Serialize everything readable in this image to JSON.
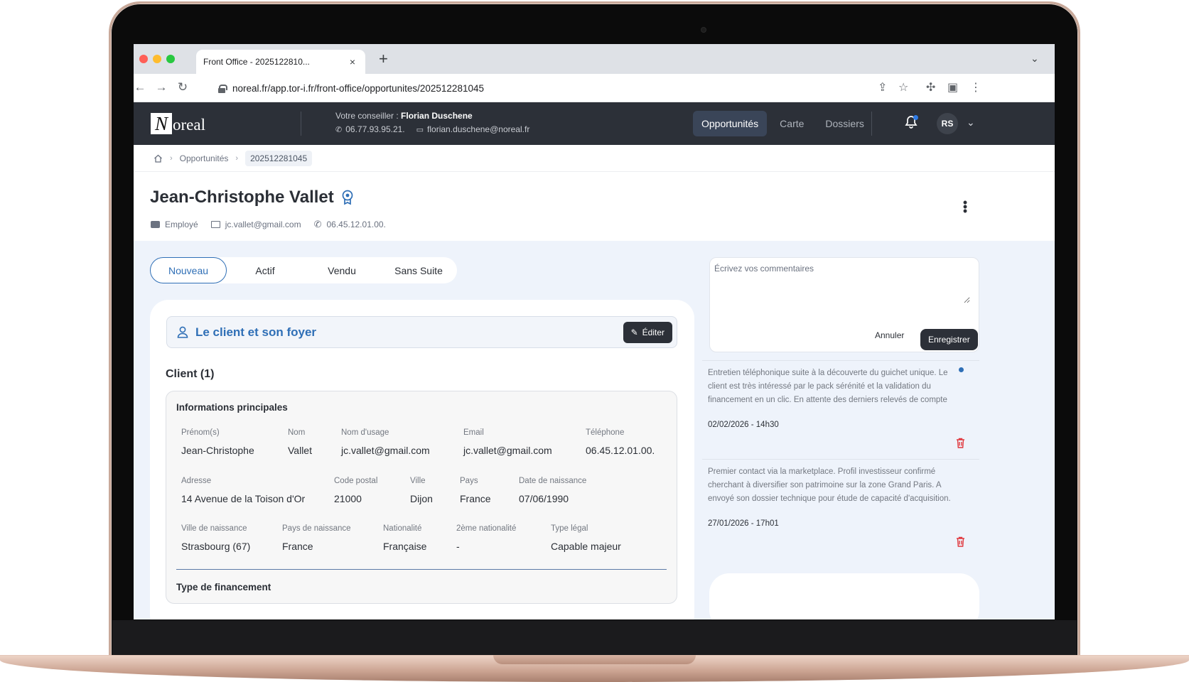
{
  "browser": {
    "tab_title": "Front Office - 2025122810...",
    "tab_close": "×",
    "new_tab": "+",
    "url": "noreal.fr/app.tor-i.fr/front-office/opportunites/202512281045"
  },
  "header": {
    "logo_letter": "N",
    "logo_rest": "oreal",
    "advisor_label": "Votre conseiller : ",
    "advisor_name": "Florian Duschene",
    "advisor_phone": "06.77.93.95.21.",
    "advisor_email": "florian.duschene@noreal.fr",
    "nav": [
      "Opportunités",
      "Carte",
      "Dossiers"
    ],
    "avatar_initials": "RS"
  },
  "breadcrumb": {
    "items": [
      "Opportunités",
      "202512281045"
    ]
  },
  "client": {
    "name": "Jean-Christophe Vallet",
    "status": "Employé",
    "email": "jc.vallet@gmail.com",
    "phone": "06.45.12.01.00."
  },
  "status_tabs": [
    "Nouveau",
    "Actif",
    "Vendu",
    "Sans Suite"
  ],
  "section": {
    "title": "Le client et son foyer",
    "edit_label": "Éditer",
    "client_count": "Client (1)",
    "info_title": "Informations principales",
    "fields": {
      "prenom": {
        "label": "Prénom(s)",
        "value": "Jean-Christophe"
      },
      "nom": {
        "label": "Nom",
        "value": "Vallet"
      },
      "nom_usage": {
        "label": "Nom d'usage",
        "value": "jc.vallet@gmail.com"
      },
      "email": {
        "label": "Email",
        "value": "jc.vallet@gmail.com"
      },
      "telephone": {
        "label": "Téléphone",
        "value": "06.45.12.01.00."
      },
      "adresse": {
        "label": "Adresse",
        "value": "14 Avenue de la Toison d'Or"
      },
      "code_postal": {
        "label": "Code postal",
        "value": "21000"
      },
      "ville": {
        "label": "Ville",
        "value": "Dijon"
      },
      "pays": {
        "label": "Pays",
        "value": "France"
      },
      "date_naissance": {
        "label": "Date de naissance",
        "value": "07/06/1990"
      },
      "ville_naissance": {
        "label": "Ville de naissance",
        "value": "Strasbourg (67)"
      },
      "pays_naissance": {
        "label": "Pays de naissance",
        "value": "France"
      },
      "nationalite": {
        "label": "Nationalité",
        "value": "Française"
      },
      "nationalite2": {
        "label": "2ème nationalité",
        "value": "-"
      },
      "type_legal": {
        "label": "Type légal",
        "value": "Capable majeur"
      }
    },
    "financement_title": "Type de financement"
  },
  "comments": {
    "placeholder": "Écrivez vos commentaires",
    "cancel_label": "Annuler",
    "save_label": "Enregistrer",
    "items": [
      {
        "text": "Entretien téléphonique suite à la découverte du guichet unique. Le client est très intéressé par le pack sérénité et la validation du financement en un clic. En attente des derniers relevés de compte",
        "date": "02/02/2026 - 14h30",
        "unread": true
      },
      {
        "text": "Premier contact via la marketplace. Profil investisseur confirmé cherchant à diversifier son patrimoine sur la zone Grand Paris. A envoyé son dossier technique pour étude de capacité d'acquisition.",
        "date": "27/01/2026 - 17h01",
        "unread": false
      }
    ]
  },
  "colors": {
    "accent": "#2f6fb6",
    "header_bg": "#2c3038",
    "body_bg": "#eef3fb",
    "danger": "#e0383e"
  }
}
